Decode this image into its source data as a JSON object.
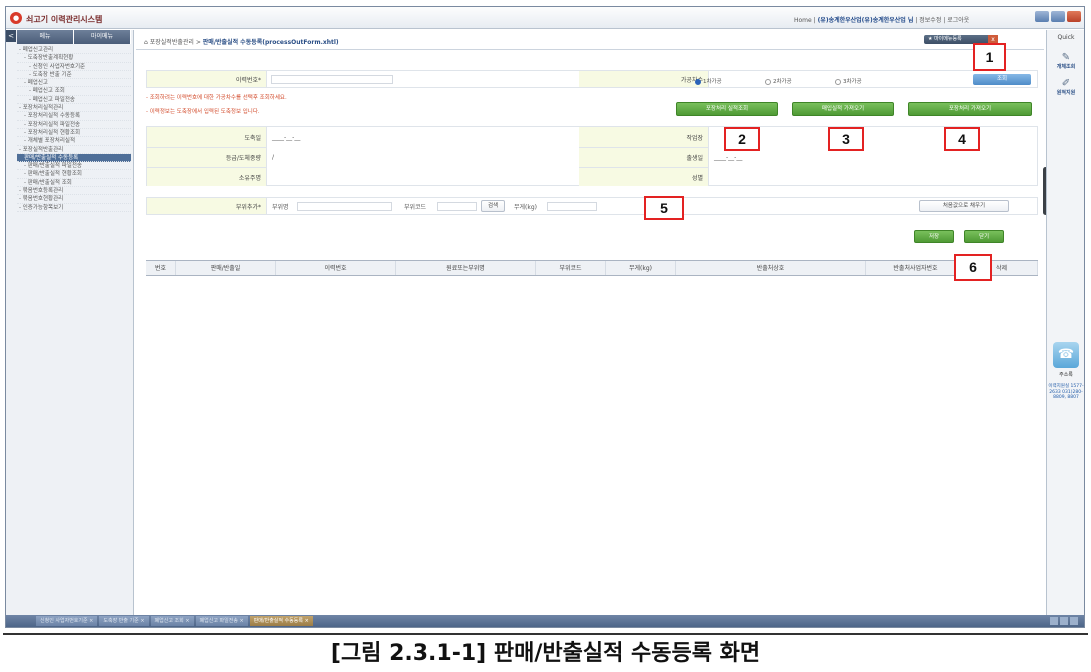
{
  "app": {
    "title": "쇠고기 이력관리시스템"
  },
  "topnav": {
    "home": "Home",
    "user": "(유)송계한우산업(유)송계한우산업 님",
    "edit_info": "정보수정",
    "logout": "로그아웃"
  },
  "sidebar": {
    "collapse": "<",
    "tabs": [
      "메뉴",
      "마이메뉴"
    ],
    "items": [
      {
        "label": "- 폐업신고관리",
        "level": 1
      },
      {
        "label": "- 도축장반출계획현황",
        "level": 2
      },
      {
        "label": "- 신청인 사업자번호기준",
        "level": 3
      },
      {
        "label": "- 도축장 반출 기준",
        "level": 3
      },
      {
        "label": "- 폐업신고",
        "level": 2
      },
      {
        "label": "- 폐업신고 조회",
        "level": 3
      },
      {
        "label": "- 폐업신고 파일전송",
        "level": 3
      },
      {
        "label": "- 포장처리실적관리",
        "level": 1
      },
      {
        "label": "- 포장처리실적 수동등록",
        "level": 2
      },
      {
        "label": "- 포장처리실적 파일전송",
        "level": 2
      },
      {
        "label": "- 포장처리실적 현황조회",
        "level": 2
      },
      {
        "label": "- 개체별 포장처리실적",
        "level": 2
      },
      {
        "label": "- 포장실적반출관리",
        "level": 1
      },
      {
        "label": "판매/반출실적 수동등록",
        "level": 2,
        "selected": true
      },
      {
        "label": "- 판매/반출실적 파일전송",
        "level": 2
      },
      {
        "label": "- 판매/반출실적 현황조회",
        "level": 2
      },
      {
        "label": "- 판매/반출실적 조회",
        "level": 2
      },
      {
        "label": "- 묶음번호등록관리",
        "level": 1
      },
      {
        "label": "- 묶음번호현황관리",
        "level": 1
      },
      {
        "label": "- 인증가능항목보기",
        "level": 1
      }
    ]
  },
  "breadcrumb": {
    "root": "포장실적반출관리",
    "sep": ">",
    "current": "판매/반출실적 수동등록(processOutForm.xhtl)"
  },
  "favorites": {
    "label": "마이메뉴등록",
    "close": "x"
  },
  "search": {
    "trace_label": "이력번호*",
    "process_label": "가공차수",
    "options": [
      "1차가공",
      "2차가공",
      "3차가공"
    ],
    "search_btn": "조회"
  },
  "notes": [
    "- 조회하려는 이력번호에 대한 가공차수를 선택후 조회하세요.",
    "- 이력정보는 도축장에서 입력된 도축정보 입니다."
  ],
  "actions": {
    "btn2": "포장처리 실적조회",
    "btn3": "매입실적 가져오기",
    "btn4": "포장처리 가져오기"
  },
  "info": {
    "slaughter_date_label": "도축일",
    "slaughter_date_value": "____-__-__",
    "workplace_label": "작업장",
    "grade_label": "등급/도체중량",
    "grade_value": "/",
    "ship_date_label": "출생일",
    "ship_date_value": "____-__-__",
    "owner_label": "소유주명",
    "sex_label": "성별"
  },
  "parts": {
    "add_label": "부위추가*",
    "part_name_label": "부위명",
    "part_code_label": "부위코드",
    "search_btn": "검색",
    "weight_label": "무게(kg)",
    "reset_btn": "처음값으로 채우기"
  },
  "grid_buttons": {
    "save": "저장",
    "close": "닫기"
  },
  "table": {
    "headers": [
      "번호",
      "판매/반출일",
      "이력번호",
      "원료또는부위명",
      "부위코드",
      "무게(kg)",
      "반출처상호",
      "반출처사업자번호",
      "삭제"
    ]
  },
  "markers": [
    "1",
    "2",
    "3",
    "4",
    "5",
    "6"
  ],
  "rightbar": {
    "quick": "Quick",
    "items": [
      "개체조회",
      "원적지원"
    ],
    "phone_label": "주소록",
    "hotline": "이력지원실 1577-2633 031)280-8809, 8807"
  },
  "taskbar": {
    "tasks": [
      {
        "label": "신청인 사업자번호기준",
        "active": false
      },
      {
        "label": "도축장 반출 기준",
        "active": false
      },
      {
        "label": "폐업신고 조회",
        "active": false
      },
      {
        "label": "폐업신고 파일전송",
        "active": false
      },
      {
        "label": "판매/반출실적 수동등록",
        "active": true
      }
    ]
  },
  "caption": "[그림 2.3.1-1] 판매/반출실적 수동등록 화면"
}
